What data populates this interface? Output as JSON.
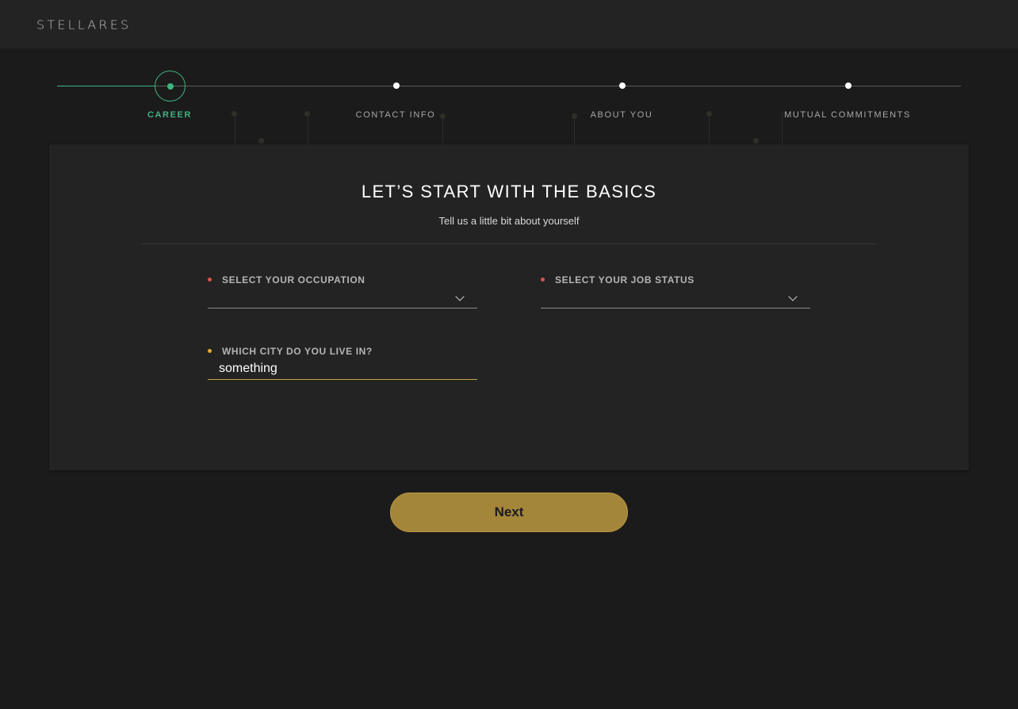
{
  "header": {
    "logo_text": "STELLARES"
  },
  "stepper": {
    "steps": [
      {
        "label": "CAREER",
        "state": "active"
      },
      {
        "label": "CONTACT INFO",
        "state": "pending"
      },
      {
        "label": "ABOUT YOU",
        "state": "pending"
      },
      {
        "label": "MUTUAL COMMITMENTS",
        "state": "pending"
      }
    ]
  },
  "card": {
    "title": "LET’S START WITH THE BASICS",
    "subtitle": "Tell us a little bit about yourself"
  },
  "form": {
    "occupation": {
      "label": "SELECT YOUR OCCUPATION",
      "value": ""
    },
    "job_status": {
      "label": "SELECT YOUR JOB STATUS",
      "value": ""
    },
    "city": {
      "label": "WHICH CITY DO YOU LIVE IN?",
      "value": "something"
    }
  },
  "actions": {
    "next_label": "Next"
  },
  "colors": {
    "accent_green": "#3fb47f",
    "accent_gold": "#a3863a",
    "required_red": "#d9534f",
    "optional_gold": "#e3a93b",
    "background": "#1c1b1c"
  }
}
